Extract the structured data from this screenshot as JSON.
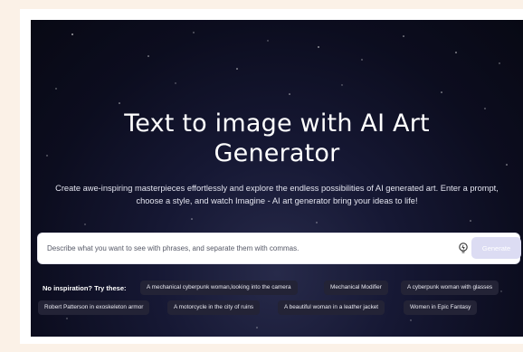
{
  "hero": {
    "title_line1": "Text to image with AI Art",
    "title_line2": "Generator",
    "subtitle_line1": "Create awe-inspiring masterpieces effortlessly and explore the endless possibilities of AI generated art. Enter a prompt,",
    "subtitle_line2": "choose a style, and watch Imagine - AI art generator bring your ideas to life!"
  },
  "prompt": {
    "placeholder": "Describe what you want to see with phrases, and separate them with commas.",
    "value": "",
    "generate_label": "Generate",
    "idea_icon": "lightbulb-icon"
  },
  "inspiration": {
    "label": "No inspiration? Try these:",
    "chips": [
      "A mechanical cyberpunk woman,looking into the camera",
      "Mechanical Modifier",
      "A cyberpunk woman with glasses",
      "Robert Patterson in exoskeleton armor",
      "A motorcycle in the city of ruins",
      "A beautiful woman in a leather jacket",
      "Women in Epic Fantasy"
    ]
  },
  "colors": {
    "page_bg": "#fbf1e7",
    "hero_bg": "#0c0d1f",
    "chip_bg": "#232336",
    "generate_bg": "#dcdcf3"
  }
}
